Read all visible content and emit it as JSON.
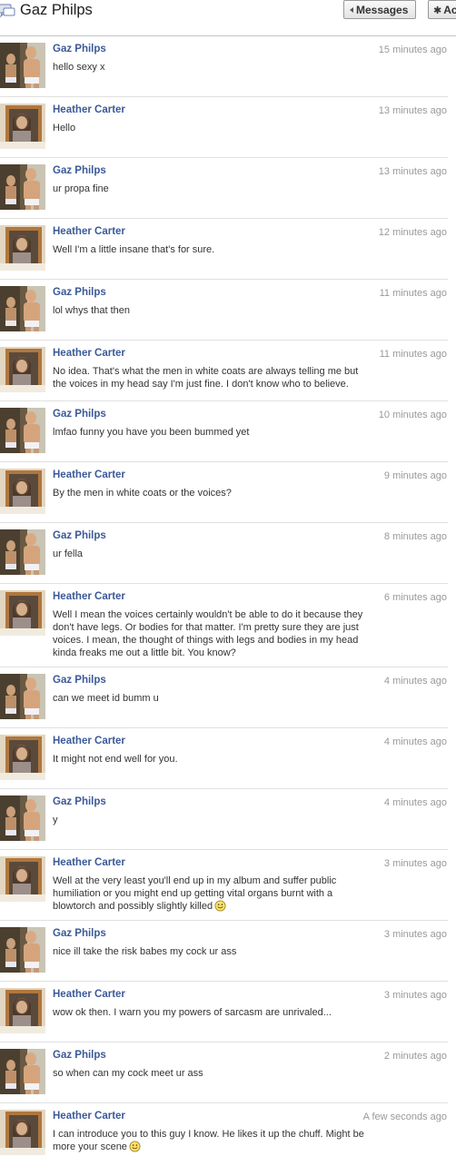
{
  "header": {
    "title": "Gaz Philps",
    "messages_button": "Messages",
    "actions_button": "Ac"
  },
  "messages": [
    {
      "sender": "Gaz Philps",
      "time": "15 minutes ago",
      "text": "hello sexy x",
      "avatar": "gaz"
    },
    {
      "sender": "Heather Carter",
      "time": "13 minutes ago",
      "text": "Hello",
      "avatar": "heather"
    },
    {
      "sender": "Gaz Philps",
      "time": "13 minutes ago",
      "text": "ur propa fine",
      "avatar": "gaz"
    },
    {
      "sender": "Heather Carter",
      "time": "12 minutes ago",
      "text": "Well I'm a little insane that's for sure.",
      "avatar": "heather"
    },
    {
      "sender": "Gaz Philps",
      "time": "11 minutes ago",
      "text": "lol whys that then",
      "avatar": "gaz"
    },
    {
      "sender": "Heather Carter",
      "time": "11 minutes ago",
      "text": "No idea. That's what the men in white coats are always telling me but the voices in my head say I'm just fine. I don't know who to believe.",
      "avatar": "heather"
    },
    {
      "sender": "Gaz Philps",
      "time": "10 minutes ago",
      "text": "lmfao funny you have you been bummed yet",
      "avatar": "gaz"
    },
    {
      "sender": "Heather Carter",
      "time": "9 minutes ago",
      "text": "By the men in white coats or the voices?",
      "avatar": "heather"
    },
    {
      "sender": "Gaz Philps",
      "time": "8 minutes ago",
      "text": "ur fella",
      "avatar": "gaz"
    },
    {
      "sender": "Heather Carter",
      "time": "6 minutes ago",
      "text": "Well I mean the voices certainly wouldn't be able to do it because they don't have legs. Or bodies for that matter. I'm pretty sure they are just voices. I mean, the thought of things with legs and bodies in my head kinda freaks me out a little bit. You know?",
      "avatar": "heather"
    },
    {
      "sender": "Gaz Philps",
      "time": "4 minutes ago",
      "text": "can we meet id bumm u",
      "avatar": "gaz"
    },
    {
      "sender": "Heather Carter",
      "time": "4 minutes ago",
      "text": "It might not end well for you.",
      "avatar": "heather"
    },
    {
      "sender": "Gaz Philps",
      "time": "4 minutes ago",
      "text": "y",
      "avatar": "gaz"
    },
    {
      "sender": "Heather Carter",
      "time": "3 minutes ago",
      "text": "Well at the very least you'll end up in my album and suffer public humiliation or you might end up getting vital organs burnt with a blowtorch and possibly slightly killed",
      "avatar": "heather",
      "smiley": true
    },
    {
      "sender": "Gaz Philps",
      "time": "3 minutes ago",
      "text": "nice ill take the risk babes my cock ur ass",
      "avatar": "gaz"
    },
    {
      "sender": "Heather Carter",
      "time": "3 minutes ago",
      "text": "wow ok then. I warn you my powers of sarcasm are unrivaled...",
      "avatar": "heather"
    },
    {
      "sender": "Gaz Philps",
      "time": "2 minutes ago",
      "text": "so when can my cock meet ur ass",
      "avatar": "gaz"
    },
    {
      "sender": "Heather Carter",
      "time": "A few seconds ago",
      "text": "I can introduce you to this guy I know. He likes it up the chuff. Might be more your scene",
      "avatar": "heather",
      "smiley": true
    }
  ]
}
